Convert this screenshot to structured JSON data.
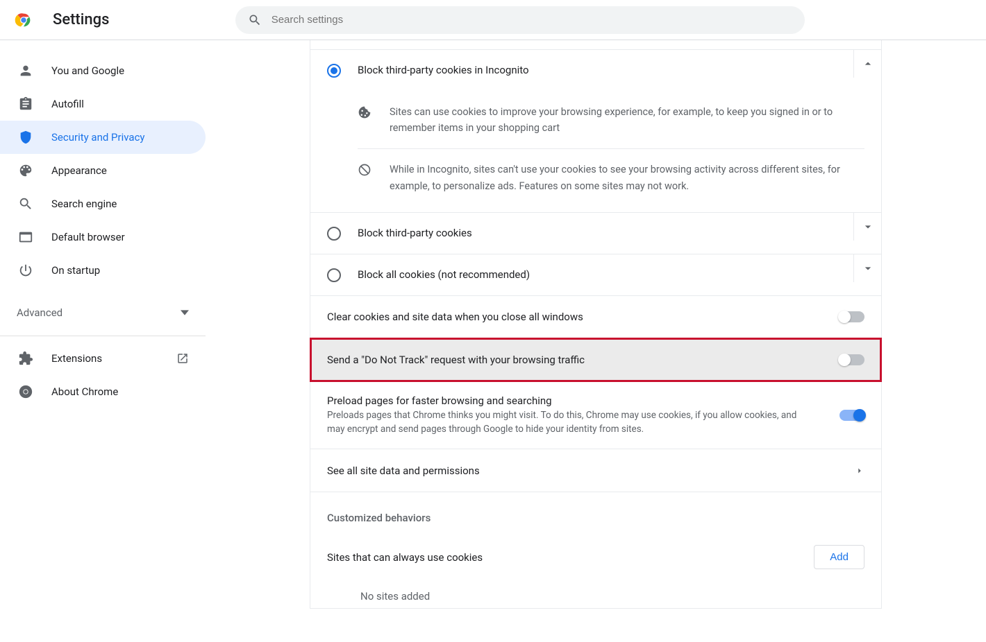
{
  "header": {
    "title": "Settings",
    "search_placeholder": "Search settings"
  },
  "sidebar": {
    "items": [
      {
        "label": "You and Google"
      },
      {
        "label": "Autofill"
      },
      {
        "label": "Security and Privacy"
      },
      {
        "label": "Appearance"
      },
      {
        "label": "Search engine"
      },
      {
        "label": "Default browser"
      },
      {
        "label": "On startup"
      }
    ],
    "advanced_label": "Advanced",
    "extensions_label": "Extensions",
    "about_label": "About Chrome"
  },
  "cookies": {
    "opt_incognito": "Block third-party cookies in Incognito",
    "detail1": "Sites can use cookies to improve your browsing experience, for example, to keep you signed in or to remember items in your shopping cart",
    "detail2": "While in Incognito, sites can't use your cookies to see your browsing activity across different sites, for example, to personalize ads. Features on some sites may not work.",
    "opt_third": "Block third-party cookies",
    "opt_all": "Block all cookies (not recommended)"
  },
  "settings": {
    "clear_close": "Clear cookies and site data when you close all windows",
    "dnt": "Send a \"Do Not Track\" request with your browsing traffic",
    "preload_title": "Preload pages for faster browsing and searching",
    "preload_sub": "Preloads pages that Chrome thinks you might visit. To do this, Chrome may use cookies, if you allow cookies, and may encrypt and send pages through Google to hide your identity from sites.",
    "see_all": "See all site data and permissions"
  },
  "custom": {
    "heading": "Customized behaviors",
    "sites_always": "Sites that can always use cookies",
    "add": "Add",
    "empty": "No sites added"
  }
}
